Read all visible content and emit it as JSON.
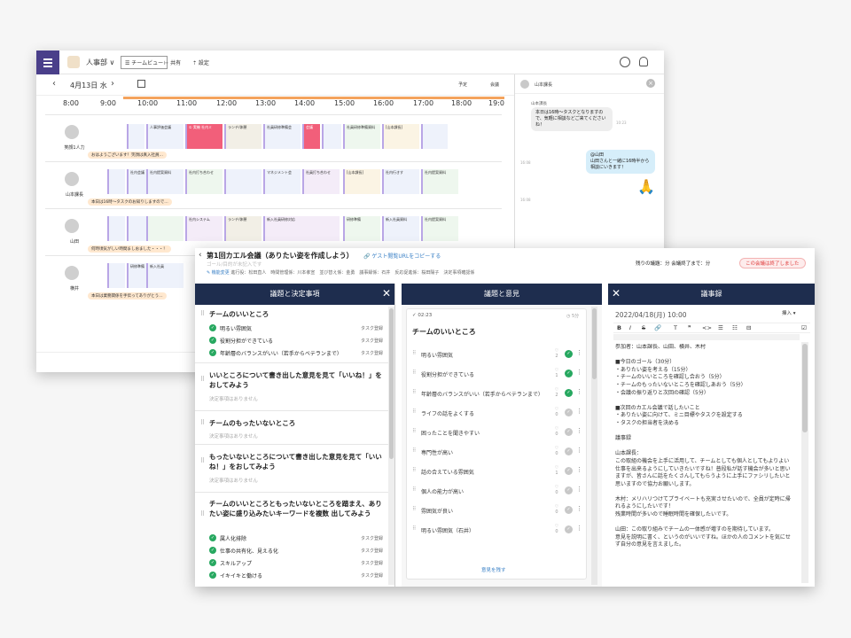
{
  "calendar": {
    "dept": "人事部 ∨",
    "team_view": "☰ チームビュー",
    "share": "⊢ 共有",
    "settings": "⇡ 設定",
    "date": "4月13日 水",
    "sched_label": "予定",
    "meeting_label": "会議",
    "times": [
      "8:00",
      "9:00",
      "10:00",
      "11:00",
      "12:00",
      "13:00",
      "14:00",
      "15:00",
      "16:00",
      "17:00",
      "18:00",
      "19:0"
    ],
    "rows": [
      {
        "name": "笑顔1人力",
        "bubble": "おはようございます！笑顔は真入社員…"
      },
      {
        "name": "山本課長",
        "bubble": "本日は16時〜タスクのお知りしますので…"
      },
      {
        "name": "山田",
        "bubble": "何時頃気がしい時間ましおました・・・！"
      },
      {
        "name": "横井",
        "bubble": "本日は業務関係を手伝ってありがとう…"
      }
    ],
    "blocks": [
      "人事評価会議",
      "社外打ち合わせ",
      "① 実機 社内ミ",
      "ランチ/休憩",
      "社員研修準備会",
      "会議",
      "社員研修準備資料",
      "社外打ち合わせ",
      "[山本課長]",
      "社内会議",
      "社内提案資料",
      "社内打ち合わせ",
      "マネジメント会",
      "社員打ち合わせ",
      "[山本課長]",
      "社内行きす",
      "社内提案資料",
      "社内システム",
      "ランチ/休憩",
      "新入社員研修対応",
      "研修準備",
      "新入社員資料",
      "社内提案資料",
      "研修準備",
      "新入社員"
    ]
  },
  "chat": {
    "header_name": "山本課長",
    "sender": "山本課長",
    "msg1": "本日は16時〜タスクとなりますので、気軽に相談などご来てくださいね！",
    "msg2_name": "@山田",
    "msg2": "山田さんと一緒に16時半から相談にいきます！",
    "time1": "10:23",
    "time2": "16:08",
    "time3": "16:08",
    "stamp": "🙏"
  },
  "meeting": {
    "back": "‹",
    "title": "第1回カエル会議（ありたい姿を作成しよう）",
    "guest_link": "🔗 ゲスト閲覧URLをコピーする",
    "goal_placeholder": "ゴール/目的が未記入です",
    "info_edit": "✎ 機能変更",
    "info_rest": "進行役：松田直人　時間管理係：川本孝宣　並び替え係：金勇　議事録係：石井　反応促進係：桜田陽子　決定事項確認係",
    "remaining": "残りの議題：分 会議終了まで：分",
    "ended": "この会議は終了しました",
    "col1": {
      "title": "議題と決定事項",
      "close": "✕",
      "agendas": [
        {
          "title": "チームのいいところ",
          "decisions": [
            {
              "text": "明るい雰囲気",
              "tag": "タスク登録"
            },
            {
              "text": "役割分担ができている",
              "tag": "タスク登録"
            },
            {
              "text": "年齢層のバランスがいい（若手からベテランまで）",
              "tag": "タスク登録"
            }
          ]
        },
        {
          "title": "いいところについて書き出した意見を見て「いいね！」をおしてみよう",
          "none": "決定事項はありません"
        },
        {
          "title": "チームのもったいないところ",
          "none": "決定事項はありません"
        },
        {
          "title": "もったいないところについて書き出した意見を見て「いいね！」をおしてみよう",
          "none": "決定事項はありません"
        },
        {
          "title": "チームのいいところともったいないところを踏まえ、ありたい姿に盛り込みたいキーワードを複数 出してみよう",
          "decisions": [
            {
              "text": "属人化排除",
              "tag": "タスク登録"
            },
            {
              "text": "仕事の共有化、見える化",
              "tag": "タスク登録"
            },
            {
              "text": "スキルアップ",
              "tag": "タスク登録"
            },
            {
              "text": "イキイキと働ける",
              "tag": "タスク登録"
            }
          ]
        }
      ]
    },
    "col2": {
      "title": "議題と意見",
      "close": "✕",
      "time": "✓ 02:23",
      "duration": "◷ 5分",
      "agenda_title": "チームのいいところ",
      "opinions": [
        {
          "text": "明るい雰囲気",
          "likes": "2",
          "done": true
        },
        {
          "text": "役割分担ができている",
          "likes": "1",
          "done": true
        },
        {
          "text": "年齢層のバランスがいい（若手からベテランまで）",
          "likes": "2",
          "done": true
        },
        {
          "text": "ライフの話をよくする",
          "likes": "0",
          "done": false
        },
        {
          "text": "困ったことを聞きやすい",
          "likes": "0",
          "done": false
        },
        {
          "text": "専門性が高い",
          "likes": "0",
          "done": false
        },
        {
          "text": "話の合えている雰囲気",
          "likes": "1",
          "done": false
        },
        {
          "text": "個人の能力が高い",
          "likes": "0",
          "done": false
        },
        {
          "text": "雰囲気が良い",
          "likes": "0",
          "done": false
        },
        {
          "text": "明るい雰囲気（石井）",
          "likes": "0",
          "done": false
        }
      ],
      "more": "意見を残す"
    },
    "col3": {
      "title": "議事録",
      "close": "✕",
      "date": "2022/04/18(月) 10:00",
      "insert": "挿入 ▾",
      "toolbar": [
        "B",
        "I",
        "S",
        "🔗",
        "T",
        "❞",
        "<>",
        "☰",
        "☷",
        "⊟",
        "☑"
      ],
      "text": "参加者：山本課長、山田、横井、木村\n\n■今日のゴール（30分）\n・ありたい姿を考える（15分）\n・チームのいいところを確認し合おう（5分）\n・チームのもったいないところを確認しあおう（5分）\n・会議の振り返りと次回の確認（5分）\n\n■次回のカエル会議で話したいこと\n・ありたい姿に向けて、ミニ目標やタスクを設定する\n・タスクの担当者を決める\n\n議事録\n\n山本課長：\nこの取組の機会を上手に活用して、チームとしても個人としてもよりよい仕事を出来るようにしていきたいですね！普段私が話す機会が多いと思いますが、皆さんに話をたくさんしてもらうように上手にファシリしたいと思いますので協力お願いします。\n\n木村：メリハリつけてプライベートも充実させたいので、全員が定時に帰れるようにしたいです！\n残業時間が多いので睡眠時間を確保したいです。\n\n山田：この取り組みでチームの一体感が増すのを期待しています。\n意見を説明に書く、というのがいいですね。ほかの人のコメントを気にせず自分の意見を言えました。"
    }
  }
}
